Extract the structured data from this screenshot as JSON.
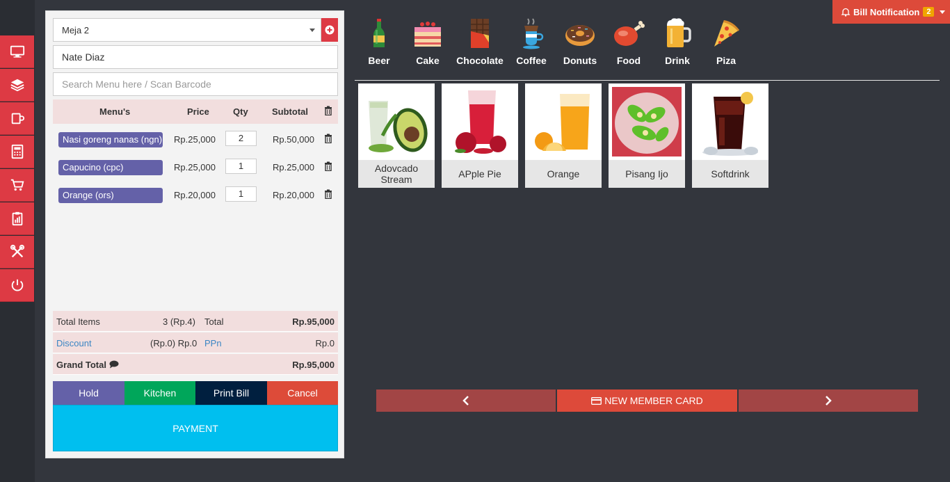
{
  "sidebar": {
    "items": [
      {
        "name": "monitor-icon"
      },
      {
        "name": "layers-icon"
      },
      {
        "name": "cup-icon"
      },
      {
        "name": "calculator-icon"
      },
      {
        "name": "cart-icon"
      },
      {
        "name": "report-icon"
      },
      {
        "name": "tools-icon"
      },
      {
        "name": "power-icon"
      }
    ]
  },
  "cart": {
    "table_value": "Meja 2",
    "customer_value": "Nate Diaz",
    "search_placeholder": "Search Menu here / Scan Barcode",
    "headers": {
      "menu": "Menu's",
      "price": "Price",
      "qty": "Qty",
      "subtotal": "Subtotal"
    },
    "items": [
      {
        "name": "Nasi goreng nanas (ngn)",
        "price": "Rp.25,000",
        "qty": "2",
        "subtotal": "Rp.50,000"
      },
      {
        "name": "Capucino (cpc)",
        "price": "Rp.25,000",
        "qty": "1",
        "subtotal": "Rp.25,000"
      },
      {
        "name": "Orange (ors)",
        "price": "Rp.20,000",
        "qty": "1",
        "subtotal": "Rp.20,000"
      }
    ],
    "summary": {
      "total_items_label": "Total Items",
      "total_items_value": "3 (Rp.4)",
      "total_label": "Total",
      "total_value": "Rp.95,000",
      "discount_label": "Discount",
      "discount_value": "(Rp.0) Rp.0",
      "ppn_label": "PPn",
      "ppn_value": "Rp.0",
      "grand_total_label": "Grand Total",
      "grand_total_value": "Rp.95,000"
    },
    "actions": {
      "hold": "Hold",
      "kitchen": "Kitchen",
      "print_bill": "Print Bill",
      "cancel": "Cancel",
      "payment": "PAYMENT"
    }
  },
  "header": {
    "bill_notification_label": "Bill Notification",
    "bill_notification_count": "2"
  },
  "categories": [
    {
      "label": "Beer",
      "icon": "beer-bottle-icon"
    },
    {
      "label": "Cake",
      "icon": "cake-icon"
    },
    {
      "label": "Chocolate",
      "icon": "chocolate-icon"
    },
    {
      "label": "Coffee",
      "icon": "coffee-icon"
    },
    {
      "label": "Donuts",
      "icon": "donut-icon"
    },
    {
      "label": "Food",
      "icon": "chicken-leg-icon"
    },
    {
      "label": "Drink",
      "icon": "beer-mug-icon"
    },
    {
      "label": "Piza",
      "icon": "pizza-icon"
    }
  ],
  "products": [
    {
      "label": "Adovcado Stream",
      "image": "avocado-smoothie"
    },
    {
      "label": "APple Pie",
      "image": "pomegranate-juice"
    },
    {
      "label": "Orange",
      "image": "orange-juice"
    },
    {
      "label": "Pisang Ijo",
      "image": "pisang-ijo-dessert"
    },
    {
      "label": "Softdrink",
      "image": "cola-glass"
    }
  ],
  "pagination": {
    "new_member_label": "NEW MEMBER CARD"
  },
  "colors": {
    "sidebar_button": "#dd3a44",
    "hold": "#6461a8",
    "kitchen": "#00a65a",
    "print_bill": "#001f3f",
    "cancel": "#dd4b39",
    "payment": "#00bfef"
  }
}
